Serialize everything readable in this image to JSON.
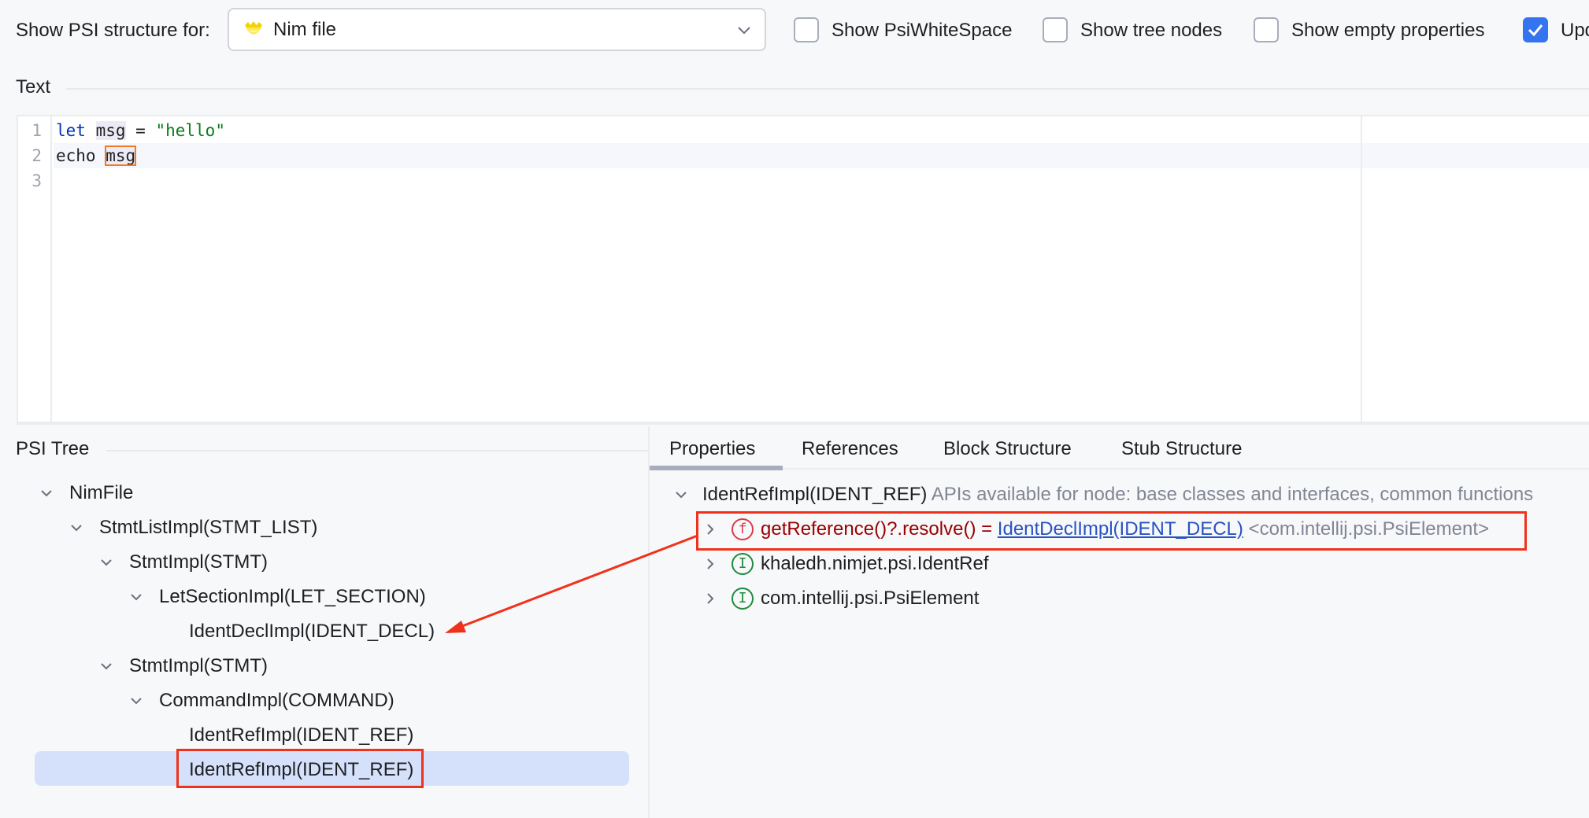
{
  "header": {
    "label": "Show PSI structure for:",
    "file_type": {
      "icon": "nim-crown-icon",
      "value": "Nim file"
    },
    "checkboxes": [
      {
        "label": "Show PsiWhiteSpace",
        "checked": false
      },
      {
        "label": "Show tree nodes",
        "checked": false
      },
      {
        "label": "Show empty properties",
        "checked": false
      },
      {
        "label": "Upd",
        "checked": true
      }
    ]
  },
  "text_section": {
    "title": "Text",
    "lines": [
      {
        "number": "1",
        "tokens": [
          {
            "t": "let",
            "k": "kw"
          },
          {
            "t": " ",
            "k": ""
          },
          {
            "t": "msg",
            "k": "ident-hl"
          },
          {
            "t": " = ",
            "k": ""
          },
          {
            "t": "\"hello\"",
            "k": "str"
          }
        ]
      },
      {
        "number": "2",
        "tokens": [
          {
            "t": "echo ",
            "k": ""
          },
          {
            "t": "msg",
            "k": "ident-box"
          }
        ]
      },
      {
        "number": "3",
        "tokens": []
      }
    ]
  },
  "psi_tree": {
    "title": "PSI Tree",
    "nodes": [
      {
        "label": "NimFile",
        "depth": 0,
        "expanded": true
      },
      {
        "label": "StmtListImpl(STMT_LIST)",
        "depth": 1,
        "expanded": true
      },
      {
        "label": "StmtImpl(STMT)",
        "depth": 2,
        "expanded": true
      },
      {
        "label": "LetSectionImpl(LET_SECTION)",
        "depth": 3,
        "expanded": true
      },
      {
        "label": "IdentDeclImpl(IDENT_DECL)",
        "depth": 4,
        "expanded": null
      },
      {
        "label": "StmtImpl(STMT)",
        "depth": 2,
        "expanded": true
      },
      {
        "label": "CommandImpl(COMMAND)",
        "depth": 3,
        "expanded": true
      },
      {
        "label": "IdentRefImpl(IDENT_REF)",
        "depth": 4,
        "expanded": null
      },
      {
        "label": "IdentRefImpl(IDENT_REF)",
        "depth": 4,
        "expanded": null,
        "selected": true
      }
    ]
  },
  "details": {
    "tabs": [
      {
        "label": "Properties",
        "active": true
      },
      {
        "label": "References",
        "active": false
      },
      {
        "label": "Block Structure",
        "active": false
      },
      {
        "label": "Stub Structure",
        "active": false
      }
    ],
    "root": {
      "label": "IdentRefImpl(IDENT_REF)",
      "hint": "APIs available for node: base classes and interfaces, common functions"
    },
    "items": [
      {
        "badge": "f",
        "kind": "function",
        "expr": "getReference()?.resolve() = ",
        "link": "IdentDeclImpl(IDENT_DECL)",
        "type": "<com.intellij.psi.PsiElement>"
      },
      {
        "badge": "I",
        "kind": "interface",
        "expr": "khaledh.nimjet.psi.IdentRef"
      },
      {
        "badge": "I",
        "kind": "interface",
        "expr": "com.intellij.psi.PsiElement"
      }
    ]
  },
  "colors": {
    "accent": "#3574f0",
    "annotation": "#f0311b",
    "selection": "#d5e1fb",
    "keyword": "#0033b3",
    "string": "#067d17",
    "link": "#2852c2",
    "function_red": "#990000"
  }
}
